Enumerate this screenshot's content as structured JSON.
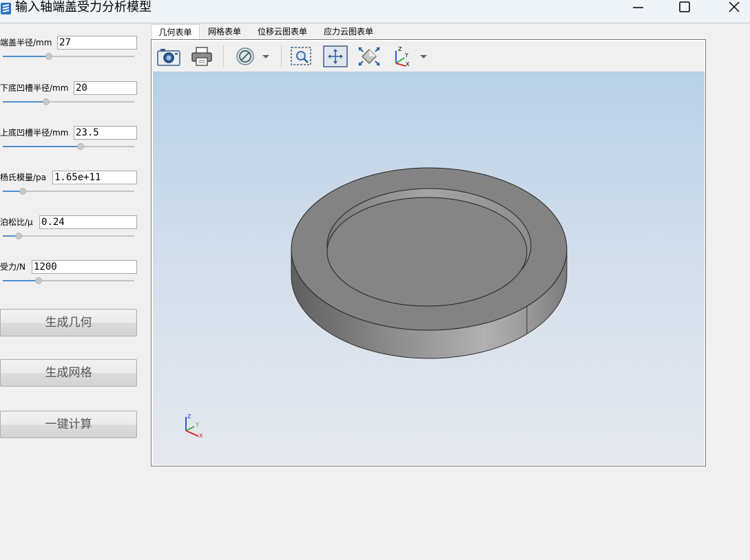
{
  "window": {
    "title": "输入轴端盖受力分析模型",
    "controls": [
      "minimize-icon",
      "maximize-icon",
      "close-icon"
    ]
  },
  "params": [
    {
      "label": "端盖半径/mm",
      "value": "27",
      "slider_fraction": 0.35
    },
    {
      "label": "下底凹槽半径/mm",
      "value": "20",
      "slider_fraction": 0.33
    },
    {
      "label": "上底凹槽半径/mm",
      "value": "23.5",
      "slider_fraction": 0.59
    },
    {
      "label": "杨氏模量/pa",
      "value": "1.65e+11",
      "slider_fraction": 0.15
    },
    {
      "label": "泊松比/μ",
      "value": "0.24",
      "slider_fraction": 0.12
    },
    {
      "label": "受力/N",
      "value": "1200",
      "slider_fraction": 0.27
    }
  ],
  "buttons": {
    "generate_geometry": "生成几何",
    "generate_mesh": "生成网格",
    "compute": "一键计算"
  },
  "tabs": [
    {
      "label": "几何表单",
      "active": true
    },
    {
      "label": "网格表单",
      "active": false
    },
    {
      "label": "位移云图表单",
      "active": false
    },
    {
      "label": "应力云图表单",
      "active": false
    }
  ],
  "toolbar_icons": [
    "camera-icon",
    "print-icon",
    "display-mode-icon",
    "dropdown-arrow-icon",
    "zoom-window-icon",
    "fit-all-icon",
    "zoom-extents-icon",
    "view-axes-icon",
    "dropdown-arrow-icon"
  ],
  "axis_labels": {
    "x": "X",
    "y": "Y",
    "z": "Z"
  },
  "colors": {
    "accent": "#4a8fcf",
    "model_gray": "#828282",
    "axis_x": "#e02020",
    "axis_y": "#2eaa2e",
    "axis_z": "#2040e0"
  }
}
